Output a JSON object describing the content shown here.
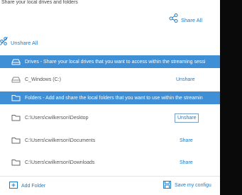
{
  "dialog": {
    "title": "Share your local drives and folders",
    "share_all_label": "Share All",
    "unshare_all_label": "Unshare All"
  },
  "sections": {
    "drives_header": "Drives - Share your local drives that you want to access within the streaming sessi",
    "folders_header": "Folders - Add and share the local folders that you want to use within the streamin"
  },
  "drives": [
    {
      "name": "C_Windows (C:)",
      "action": "Unshare"
    }
  ],
  "folders": [
    {
      "name": "C:\\Users\\cwilkerson\\Desktop",
      "action": "Unshare"
    },
    {
      "name": "C:\\Users\\cwilkerson\\Documents",
      "action": "Share"
    },
    {
      "name": "C:\\Users\\cwilkerson\\Downloads",
      "action": "Share"
    }
  ],
  "footer": {
    "add_folder_label": "Add Folder",
    "save_label": "Save my configu"
  },
  "colors": {
    "accent": "#1e7ac9",
    "header_bg": "#3e8fd6",
    "right_panel": "#0a0a0a"
  }
}
